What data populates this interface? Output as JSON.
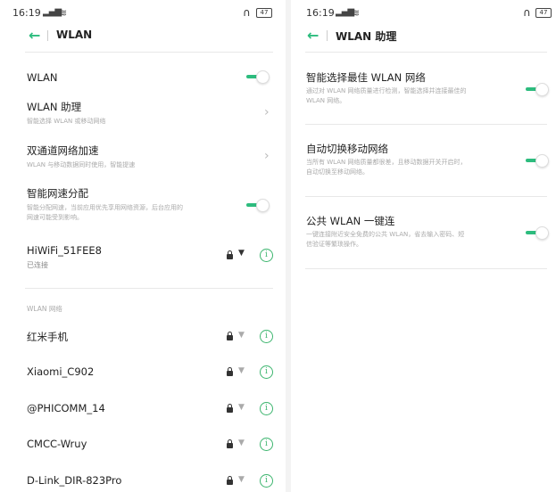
{
  "left": {
    "status": {
      "time": "16:19",
      "signal": "▂▄▆",
      "wifi_icon": "wifi-icon",
      "battery": "47"
    },
    "header": {
      "title": "WLAN"
    },
    "wlan": {
      "label": "WLAN",
      "enabled": true
    },
    "assistant": {
      "label": "WLAN 助理",
      "sub": "智能选择 WLAN 或移动网络"
    },
    "dual": {
      "label": "双通道网络加速",
      "sub": "WLAN 与移动数据同时使用，智能提速"
    },
    "smart": {
      "label": "智能网速分配",
      "sub1": "智能分配网速，当前应用优先享用网络资源，后台应用的",
      "sub2": "网速可能受到影响。",
      "enabled": true
    },
    "connected": {
      "ssid": "HiWiFi_51FEE8",
      "status": "已连接"
    },
    "section_title": "WLAN 网络",
    "networks": [
      {
        "ssid": "红米手机"
      },
      {
        "ssid": "Xiaomi_C902"
      },
      {
        "ssid": "@PHICOMM_14"
      },
      {
        "ssid": "CMCC-Wruy"
      },
      {
        "ssid": "D-Link_DIR-823Pro"
      }
    ]
  },
  "right": {
    "status": {
      "time": "16:19",
      "battery": "47"
    },
    "header": {
      "title": "WLAN 助理"
    },
    "items": [
      {
        "label": "智能选择最佳 WLAN 网络",
        "sub1": "通过对 WLAN 网络质量进行检测，智能选择并连接最佳的",
        "sub2": "WLAN 网络。",
        "enabled": true
      },
      {
        "label": "自动切换移动网络",
        "sub1": "当所有 WLAN 网络质量都很差，且移动数据开关开启时，",
        "sub2": "自动切换至移动网络。",
        "enabled": true
      },
      {
        "label": "公共 WLAN 一键连",
        "sub1": "一键连接附近安全免费的公共 WLAN，省去输入密码、短",
        "sub2": "信验证等繁琐操作。",
        "enabled": true
      }
    ]
  },
  "colors": {
    "accent": "#2dbc7e",
    "info": "#3cb56e"
  }
}
